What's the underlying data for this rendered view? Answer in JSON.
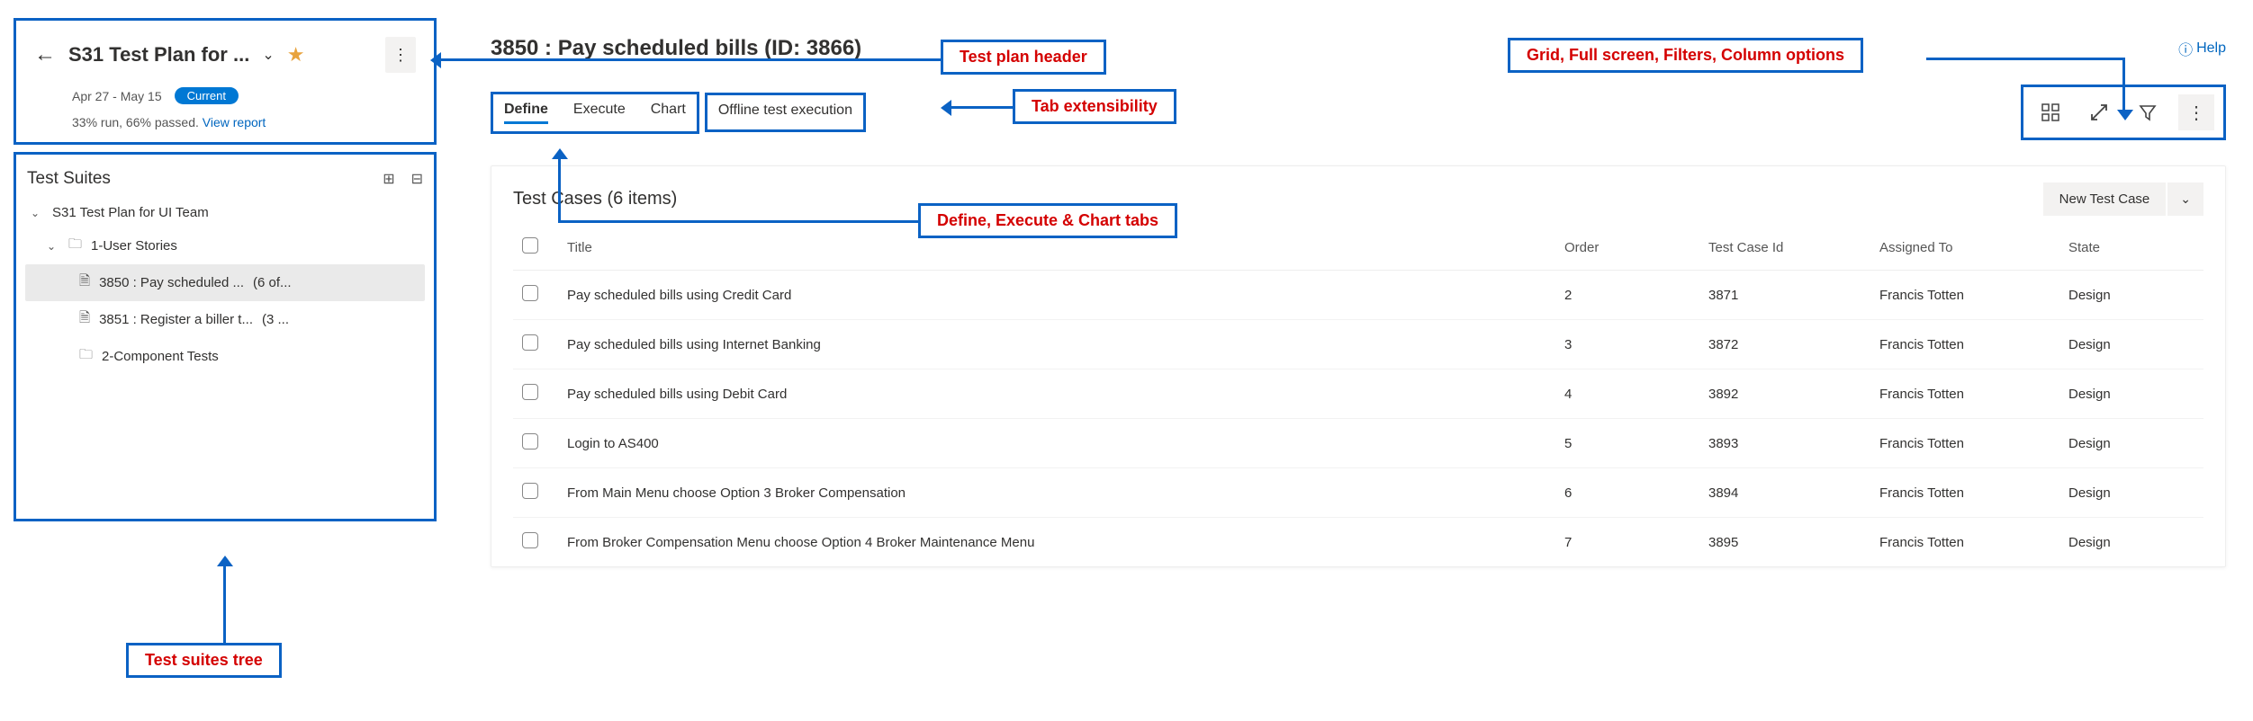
{
  "planHeader": {
    "title": "S31 Test Plan for ...",
    "dateRange": "Apr 27 - May 15",
    "currentBadge": "Current",
    "statsPrefix": "33% run, 66% passed.",
    "viewReport": "View report"
  },
  "suites": {
    "heading": "Test Suites",
    "root": "S31 Test Plan for UI Team",
    "node1": "1-User Stories",
    "leaf1": "3850 : Pay scheduled ...",
    "leaf1Count": "(6 of...",
    "leaf2": "3851 : Register a biller t...",
    "leaf2Count": "(3 ...",
    "node2": "2-Component Tests"
  },
  "main": {
    "title": "3850 : Pay scheduled bills (ID: 3866)",
    "help": "Help"
  },
  "tabs": {
    "define": "Define",
    "execute": "Execute",
    "chart": "Chart",
    "offline": "Offline test execution"
  },
  "card": {
    "title": "Test Cases (6 items)",
    "newBtn": "New Test Case"
  },
  "columns": {
    "title": "Title",
    "order": "Order",
    "id": "Test Case Id",
    "assigned": "Assigned To",
    "state": "State"
  },
  "rows": [
    {
      "title": "Pay scheduled bills using Credit Card",
      "order": "2",
      "id": "3871",
      "assigned": "Francis Totten",
      "state": "Design"
    },
    {
      "title": "Pay scheduled bills using Internet Banking",
      "order": "3",
      "id": "3872",
      "assigned": "Francis Totten",
      "state": "Design"
    },
    {
      "title": "Pay scheduled bills using Debit Card",
      "order": "4",
      "id": "3892",
      "assigned": "Francis Totten",
      "state": "Design"
    },
    {
      "title": "Login to AS400",
      "order": "5",
      "id": "3893",
      "assigned": "Francis Totten",
      "state": "Design"
    },
    {
      "title": "From Main Menu choose Option 3 Broker Compensation",
      "order": "6",
      "id": "3894",
      "assigned": "Francis Totten",
      "state": "Design"
    },
    {
      "title": "From Broker Compensation Menu choose Option 4 Broker Maintenance Menu",
      "order": "7",
      "id": "3895",
      "assigned": "Francis Totten",
      "state": "Design"
    }
  ],
  "callouts": {
    "planHeader": "Test plan header",
    "toolbar": "Grid, Full screen, Filters, Column options",
    "tabExt": "Tab extensibility",
    "tabsMain": "Define, Execute & Chart tabs",
    "suitesTree": "Test suites tree"
  }
}
